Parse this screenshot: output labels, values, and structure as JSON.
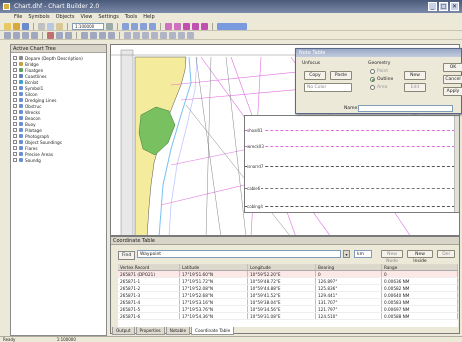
{
  "window": {
    "title": "Chart.dhf - Chart Builder 2.0",
    "controls": [
      "_",
      "□",
      "✕"
    ]
  },
  "menu": [
    "File",
    "Symbols",
    "Objects",
    "View",
    "Settings",
    "Tools",
    "Help"
  ],
  "toolbar": {
    "zoom_value": "1:100000"
  },
  "tree": {
    "title": "Active Chart Tree",
    "items": [
      "Depare (Depth Description)",
      "Bridge",
      "Floatgen",
      "Coastlines",
      "Bcnlat",
      "Symbol1",
      "Silcon",
      "Dredging Lines",
      "Obstruc",
      "Wrecks",
      "Beacon",
      "Buoy",
      "Pilotage",
      "Photograph",
      "Object Soundings",
      "Flares",
      "Precise Areas",
      "Soundg"
    ]
  },
  "dialog": {
    "title": "Note Table",
    "group_left": "Unfocus",
    "copy": "Copy",
    "paste": "Paste",
    "combo": "No Color",
    "group_right": "Geometry",
    "radio_1": "Point",
    "radio_2": "Outline",
    "radio_3": "Area",
    "new": "New",
    "edit": "Edit",
    "ok": "OK",
    "cancel": "Cancel",
    "apply": "Apply",
    "name_label": "Name:",
    "notes": [
      "shoal01",
      "wreck03",
      "isnarrd7",
      "cable6",
      "coblng4"
    ]
  },
  "coord": {
    "title": "Coordinate Table",
    "find_label": "Find",
    "find_value": "Waypoint",
    "unit": "km",
    "btn_new": "New Node",
    "btn_new_inside": "New Inside",
    "btn_delete": "Del",
    "columns": [
      "Vertex Record",
      "Latitude",
      "Longitude",
      "Bearing",
      "Range"
    ],
    "rows": [
      [
        "265871 (DPO21)",
        "17°19'51.60\"N",
        "10°59'52.20\"E",
        "0",
        "0"
      ],
      [
        "265871-1",
        "17°19'51.72\"N",
        "10°59'48.72\"E",
        "126.897°",
        "0.00636 NM"
      ],
      [
        "265871-2",
        "17°19'52.08\"N",
        "10°59'44.88\"E",
        "125.836°",
        "0.00582 NM"
      ],
      [
        "265871-3",
        "17°19'52.68\"N",
        "10°59'41.52\"E",
        "129.441°",
        "0.00640 NM"
      ],
      [
        "265871-4",
        "17°19'53.16\"N",
        "10°59'38.04\"E",
        "131.707°",
        "0.00583 NM"
      ],
      [
        "265871-5",
        "17°19'53.76\"N",
        "10°59'34.56\"E",
        "121.797°",
        "0.00697 NM"
      ],
      [
        "265871-6",
        "17°19'54.36\"N",
        "10°59'31.08\"E",
        "124.510°",
        "0.00588 NM"
      ]
    ]
  },
  "tabs": [
    "Output",
    "Properties",
    "Notable",
    "Coordinate Table"
  ],
  "status": {
    "left": "Ready",
    "mid": "1:100000"
  }
}
